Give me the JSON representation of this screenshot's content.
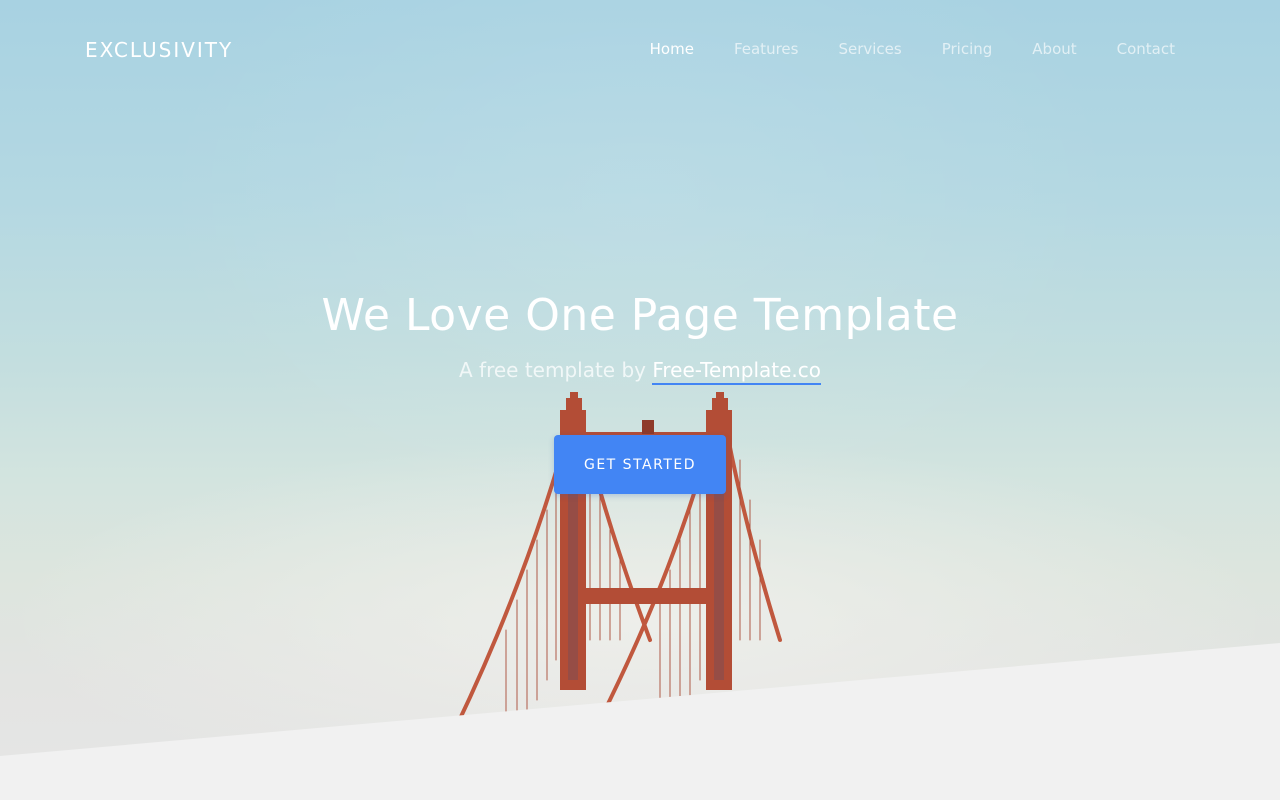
{
  "header": {
    "brand": "EXCLUSIVITY",
    "nav": [
      {
        "label": "Home",
        "active": true
      },
      {
        "label": "Features",
        "active": false
      },
      {
        "label": "Services",
        "active": false
      },
      {
        "label": "Pricing",
        "active": false
      },
      {
        "label": "About",
        "active": false
      },
      {
        "label": "Contact",
        "active": false
      }
    ]
  },
  "hero": {
    "title": "We Love One Page Template",
    "subtitle_prefix": "A free template by ",
    "subtitle_link": "Free-Template.co",
    "cta_label": "GET STARTED"
  },
  "colors": {
    "accent": "#4285f4",
    "section_bg": "#f1f1f1",
    "bridge": "#b5523a"
  }
}
